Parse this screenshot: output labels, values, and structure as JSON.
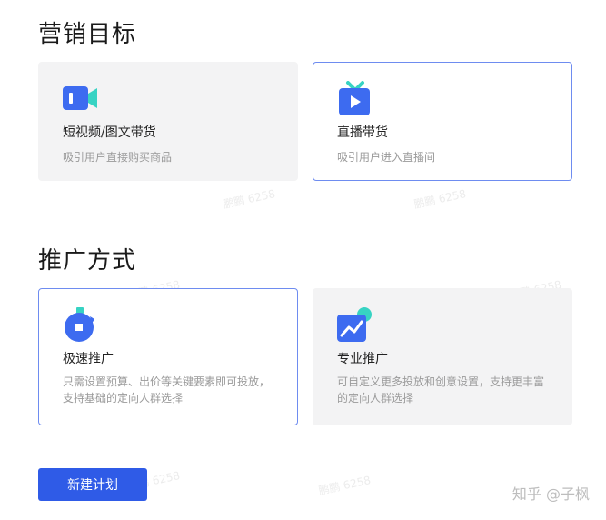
{
  "sections": {
    "goal_title": "营销目标",
    "method_title": "推广方式"
  },
  "goal_cards": [
    {
      "title": "短视频/图文带货",
      "desc": "吸引用户直接购买商品",
      "icon": "video-camera-icon",
      "selected": false
    },
    {
      "title": "直播带货",
      "desc": "吸引用户进入直播间",
      "icon": "tv-play-icon",
      "selected": true
    }
  ],
  "method_cards": [
    {
      "title": "极速推广",
      "desc": "只需设置预算、出价等关键要素即可投放，支持基础的定向人群选择",
      "icon": "stopwatch-icon",
      "selected": true
    },
    {
      "title": "专业推广",
      "desc": "可自定义更多投放和创意设置，支持更丰富的定向人群选择",
      "icon": "trend-chart-icon",
      "selected": false
    }
  ],
  "actions": {
    "create_label": "新建计划"
  },
  "watermark": {
    "text": "鹏鹏 6258"
  },
  "credit": "知乎 @子枫",
  "colors": {
    "accent": "#2f5be7",
    "selected_border": "#6e8cf0",
    "card_bg": "#f3f3f4",
    "icon_blue": "#3d6bf0",
    "icon_teal": "#37d3c3"
  }
}
